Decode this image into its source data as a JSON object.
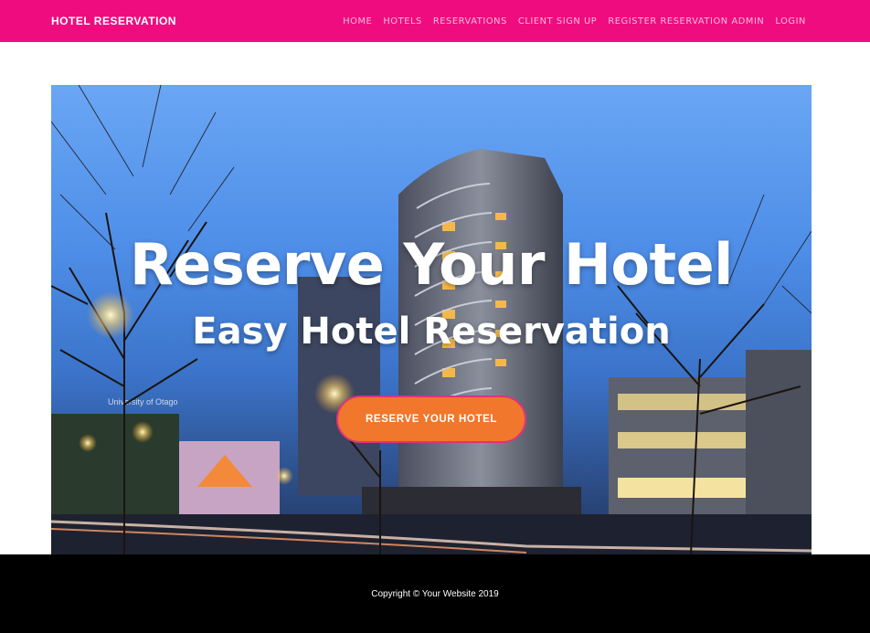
{
  "navbar": {
    "brand": "HOTEL RESERVATION",
    "links": [
      "HOME",
      "HOTELS",
      "RESERVATIONS",
      "CLIENT SIGN UP",
      "REGISTER RESERVATION ADMIN",
      "LOGIN"
    ],
    "background_color": "#ef0c7f"
  },
  "hero": {
    "title": "Reserve Your Hotel",
    "subtitle": "Easy Hotel Reservation",
    "button_label": "RESERVE YOUR HOTEL",
    "button_color": "#f0772b"
  },
  "footer": {
    "copyright": "Copyright © Your Website 2019",
    "background_color": "#000000"
  }
}
